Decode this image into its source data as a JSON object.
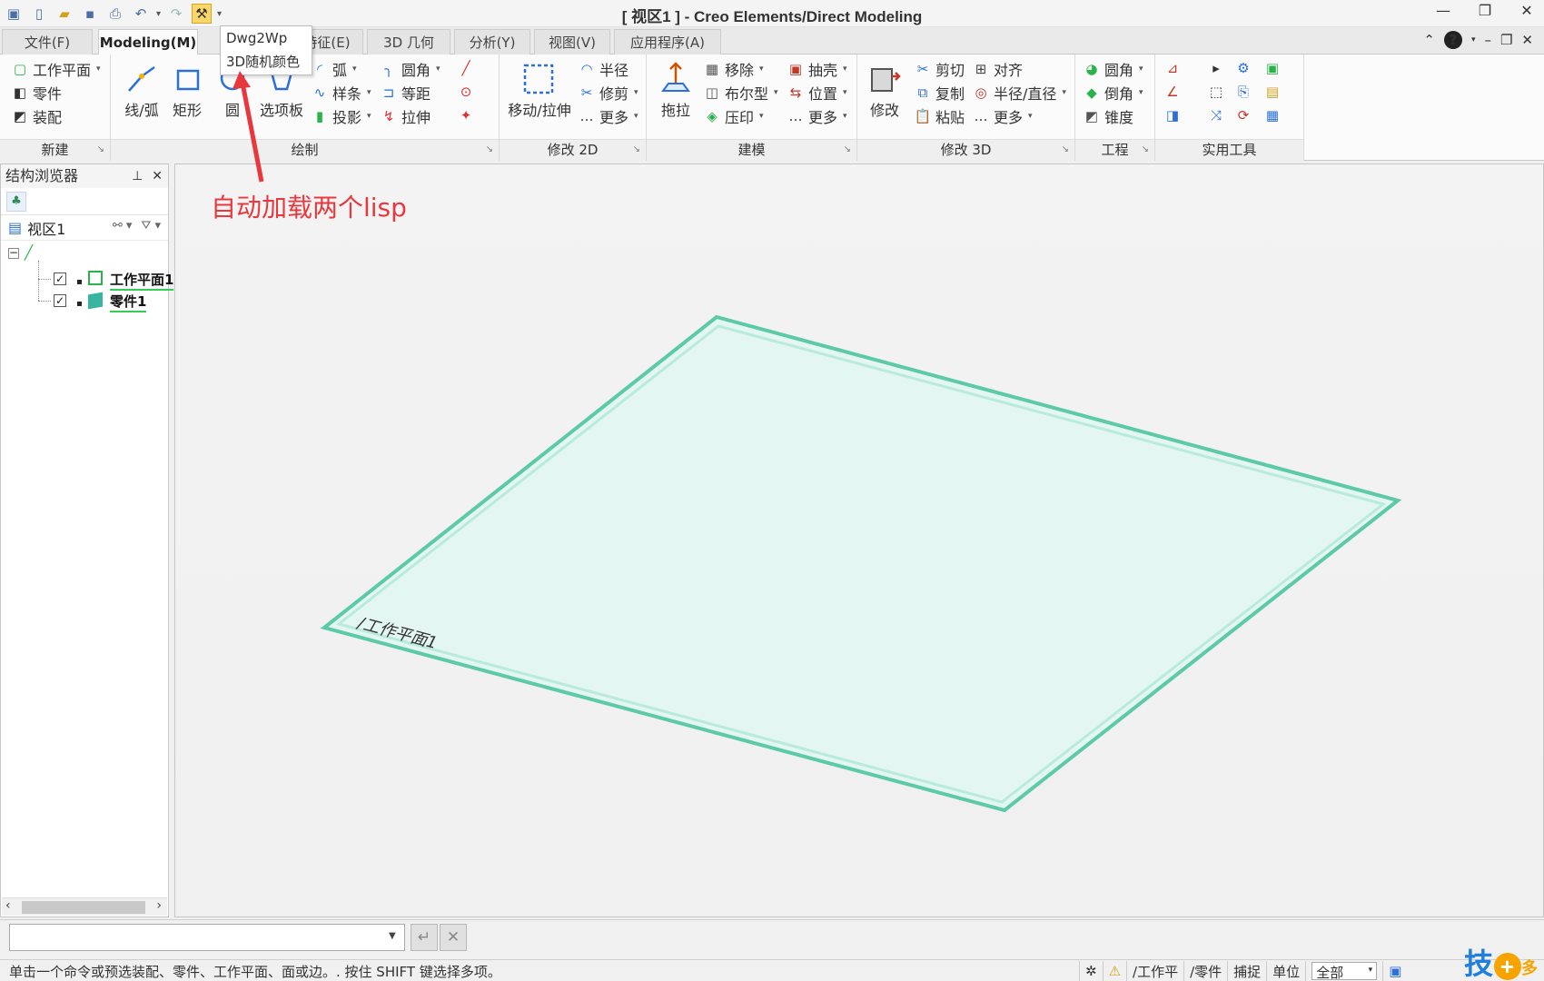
{
  "window": {
    "title": "[ 视区1 ] - Creo Elements/Direct Modeling",
    "controls": [
      "minimize",
      "restore",
      "close"
    ]
  },
  "quick_access": {
    "icons": [
      "app-icon",
      "new-icon",
      "open-icon",
      "save-icon",
      "print-preview-icon",
      "undo-icon",
      "redo-icon",
      "lisp-tools-icon"
    ],
    "menu": {
      "items": [
        "Dwg2Wp",
        "3D随机颜色"
      ]
    }
  },
  "tabs": [
    {
      "label": "文件(F)",
      "active": false
    },
    {
      "label": "Modeling(M)",
      "active": true
    },
    {
      "label": "特征(E)",
      "active": false
    },
    {
      "label": "3D 几何",
      "active": false
    },
    {
      "label": "分析(Y)",
      "active": false
    },
    {
      "label": "视图(V)",
      "active": false
    },
    {
      "label": "应用程序(A)",
      "active": false
    }
  ],
  "ribbon": {
    "groups": {
      "new": {
        "title": "新建",
        "items": [
          "工作平面",
          "零件",
          "装配"
        ]
      },
      "draw": {
        "title": "绘制",
        "big_buttons": [
          "线/弧",
          "矩形",
          "圆",
          "选项板"
        ],
        "small_col1": [
          "弧",
          "样条",
          "投影"
        ],
        "small_col2": [
          "圆角",
          "等距",
          "拉伸"
        ]
      },
      "modify2d": {
        "title": "修改 2D",
        "big_button": "移动/拉伸",
        "items": [
          "半径",
          "修剪",
          "更多"
        ]
      },
      "modeling": {
        "title": "建模",
        "big_button": "拖拉",
        "col1": [
          "移除",
          "布尔型",
          "压印"
        ],
        "col2": [
          "抽壳",
          "位置",
          "更多"
        ]
      },
      "modify3d": {
        "title": "修改 3D",
        "big_button": "修改",
        "col1": [
          "剪切",
          "复制",
          "粘贴"
        ],
        "col2": [
          "对齐",
          "半径/直径",
          "更多"
        ]
      },
      "engineering": {
        "title": "工程",
        "items": [
          "圆角",
          "倒角",
          "锥度"
        ]
      },
      "utilities": {
        "title": "实用工具"
      }
    }
  },
  "structure_browser": {
    "title": "结构浏览器",
    "view_label": "视区1",
    "tree": [
      {
        "label": "工作平面1",
        "checked": true
      },
      {
        "label": "零件1",
        "checked": true
      }
    ]
  },
  "viewport": {
    "workplane_label": "/工作平面1"
  },
  "command_line": {
    "value": "",
    "placeholder": ""
  },
  "status": {
    "message": "单击一个命令或预选装配、零件、工作平面、面或边。. 按住 SHIFT 键选择多项。",
    "cells": [
      "/工作平",
      "/零件",
      "捕捉",
      "单位"
    ],
    "filter_value": "全部"
  },
  "annotation": {
    "text": "自动加载两个lisp",
    "color": "#e8383d"
  },
  "watermark": {
    "text_left": "技",
    "text_right": "多"
  },
  "colors": {
    "workplane_fill": "#e4f6f1",
    "workplane_edge": "#5cc9a7",
    "accent_highlight": "#fbd66a"
  }
}
